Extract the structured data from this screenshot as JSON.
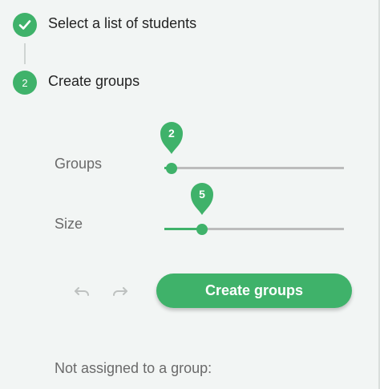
{
  "colors": {
    "accent": "#3fb26a",
    "track": "#bcbcbc",
    "background": "#f2f5f4"
  },
  "steps": [
    {
      "state": "complete",
      "icon": "check-icon",
      "label": "Select a list of students"
    },
    {
      "state": "active",
      "number": "2",
      "label": "Create groups"
    }
  ],
  "sliders": {
    "groups": {
      "label": "Groups",
      "value": "2",
      "fraction": 0.04
    },
    "size": {
      "label": "Size",
      "value": "5",
      "fraction": 0.21
    }
  },
  "toolbar": {
    "undo_icon": "undo-icon",
    "redo_icon": "redo-icon"
  },
  "create_button": {
    "label": "Create groups"
  },
  "unassigned": {
    "label": "Not assigned to a group:"
  }
}
